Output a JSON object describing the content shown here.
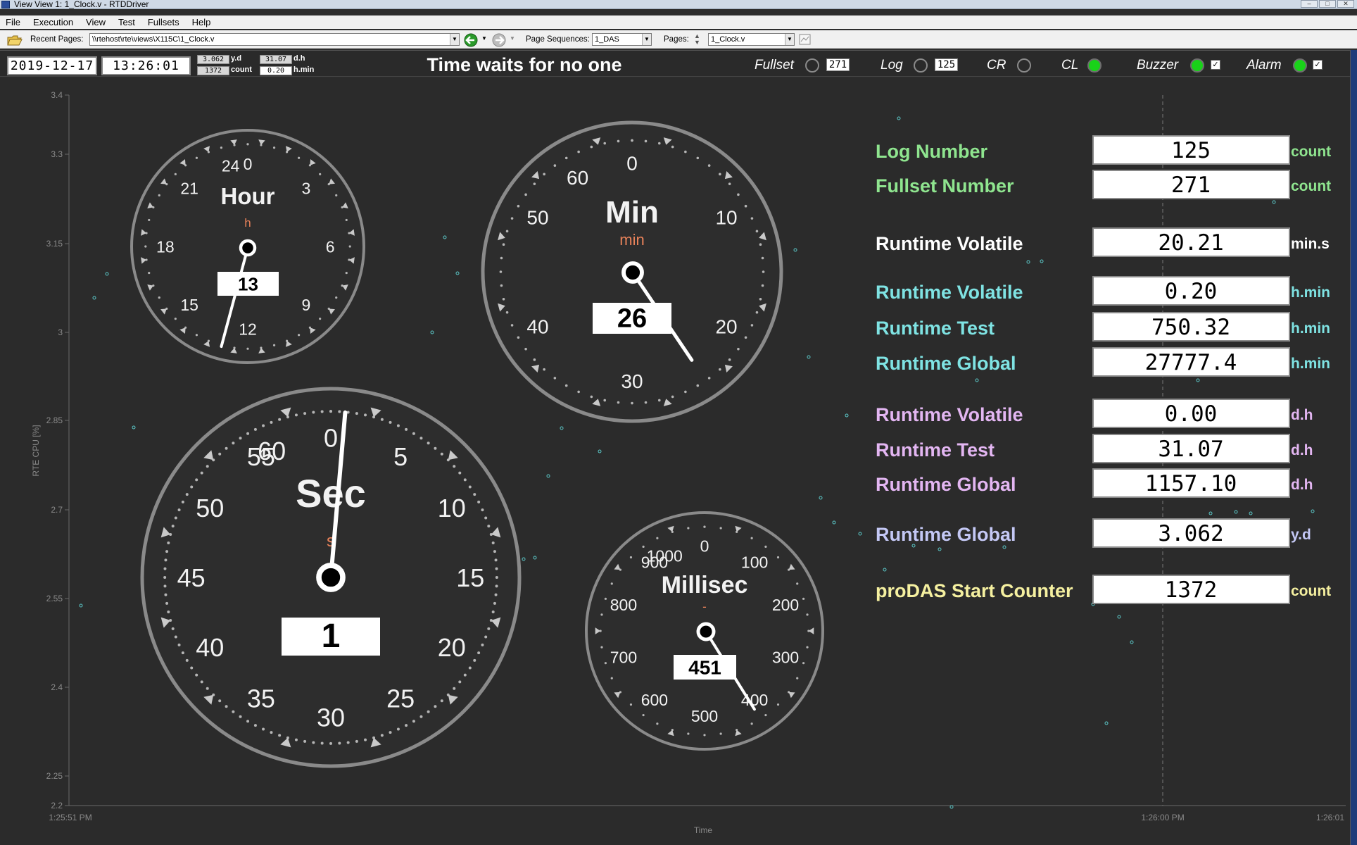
{
  "window": {
    "title": "View View 1: 1_Clock.v - RTDDriver"
  },
  "menu": [
    "File",
    "Execution",
    "View",
    "Test",
    "Fullsets",
    "Help"
  ],
  "toolbar": {
    "recent_pages_label": "Recent Pages:",
    "recent_pages_value": "\\\\rtehost\\rte\\views\\X115C\\1_Clock.v",
    "page_sequences_label": "Page Sequences:",
    "page_sequences_value": "1_DAS",
    "pages_label": "Pages:",
    "pages_value": "1_Clock.v"
  },
  "header": {
    "date": "2019-12-17",
    "time": "13:26:01",
    "mini": [
      {
        "value": "3.062",
        "unit": "y.d"
      },
      {
        "value": "31.07",
        "unit": "d.h"
      },
      {
        "value": "1372",
        "unit": "count"
      },
      {
        "value": "0.20",
        "unit": "h.min"
      }
    ],
    "banner": "Time waits for no one",
    "flags": {
      "fullset": {
        "label": "Fullset",
        "value": "271"
      },
      "log": {
        "label": "Log",
        "value": "125"
      },
      "cr": {
        "label": "CR"
      },
      "cl": {
        "label": "CL"
      },
      "buzzer": {
        "label": "Buzzer",
        "check": "✓"
      },
      "alarm": {
        "label": "Alarm",
        "check": "✓"
      }
    },
    "colors": {
      "led_on": "#19d219"
    }
  },
  "background_chart": {
    "ylabel": "RTE CPU [%]",
    "xlabel": "Time",
    "yticks": [
      "3.4",
      "3.3",
      "3.15",
      "3",
      "2.85",
      "2.7",
      "2.55",
      "2.4",
      "2.25",
      "2.2"
    ],
    "xticks": [
      "1:25:51 PM",
      "1:26:00 PM",
      "1:26:01"
    ]
  },
  "gauges": {
    "hour": {
      "title": "Hour",
      "unit": "h",
      "value": "13",
      "labels": [
        "0",
        "3",
        "6",
        "9",
        "12",
        "15",
        "18",
        "21",
        "24"
      ]
    },
    "min": {
      "title": "Min",
      "unit": "min",
      "value": "26",
      "labels": [
        "0",
        "10",
        "20",
        "30",
        "40",
        "50",
        "60"
      ]
    },
    "sec": {
      "title": "Sec",
      "unit": "s",
      "value": "1",
      "labels": [
        "0",
        "5",
        "10",
        "15",
        "20",
        "25",
        "30",
        "35",
        "40",
        "45",
        "50",
        "55",
        "60"
      ]
    },
    "msec": {
      "title": "Millisec",
      "unit": "-",
      "value": "451",
      "labels": [
        "0",
        "100",
        "200",
        "300",
        "400",
        "500",
        "600",
        "700",
        "800",
        "900",
        "1000"
      ]
    }
  },
  "readouts": [
    {
      "label": "Log Number",
      "value": "125",
      "unit": "count",
      "color": "#8fe58f"
    },
    {
      "label": "Fullset Number",
      "value": "271",
      "unit": "count",
      "color": "#8fe58f"
    },
    {
      "label": "Runtime Volatile",
      "value": "20.21",
      "unit": "min.s",
      "color": "#ffffff"
    },
    {
      "label": "Runtime Volatile",
      "value": "0.20",
      "unit": "h.min",
      "color": "#7fe3e3"
    },
    {
      "label": "Runtime Test",
      "value": "750.32",
      "unit": "h.min",
      "color": "#7fe3e3"
    },
    {
      "label": "Runtime Global",
      "value": "27777.4",
      "unit": "h.min",
      "color": "#7fe3e3"
    },
    {
      "label": "Runtime Volatile",
      "value": "0.00",
      "unit": "d.h",
      "color": "#e3b6f2"
    },
    {
      "label": "Runtime Test",
      "value": "31.07",
      "unit": "d.h",
      "color": "#e3b6f2"
    },
    {
      "label": "Runtime Global",
      "value": "1157.10",
      "unit": "d.h",
      "color": "#e3b6f2"
    },
    {
      "label": "Runtime Global",
      "value": "3.062",
      "unit": "y.d",
      "color": "#c4c8f5"
    },
    {
      "label": "proDAS Start Counter",
      "value": "1372",
      "unit": "count",
      "color": "#f5f0a0"
    }
  ]
}
